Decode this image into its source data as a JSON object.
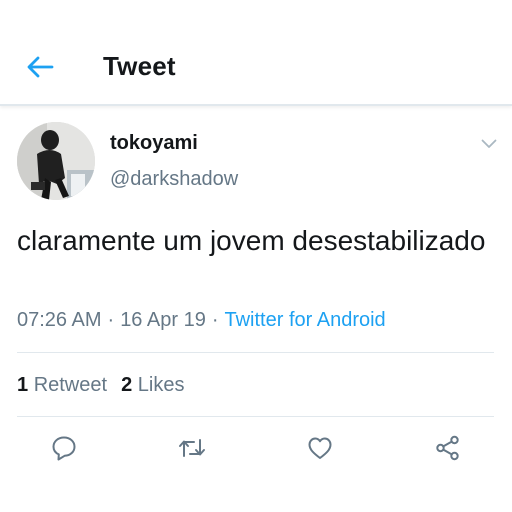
{
  "colors": {
    "accent": "#1da1f2",
    "text_primary": "#14171a",
    "text_secondary": "#657786",
    "divider": "#e1e8ed"
  },
  "header": {
    "back_icon": "arrow-left-icon",
    "title": "Tweet"
  },
  "author": {
    "avatar": "profile-photo",
    "display_name": "tokoyami",
    "handle": "@darkshadow",
    "menu_icon": "chevron-down-icon"
  },
  "tweet": {
    "text": "claramente um jovem desestabilizado",
    "time": "07:26 AM",
    "separator": "·",
    "date": "16 Apr 19",
    "source": "Twitter for Android"
  },
  "stats": {
    "retweet_count": "1",
    "retweet_label": "Retweet",
    "like_count": "2",
    "like_label": "Likes"
  },
  "actions": [
    {
      "name": "reply",
      "icon": "reply-icon"
    },
    {
      "name": "retweet",
      "icon": "retweet-icon"
    },
    {
      "name": "like",
      "icon": "heart-icon"
    },
    {
      "name": "share",
      "icon": "share-icon"
    }
  ]
}
